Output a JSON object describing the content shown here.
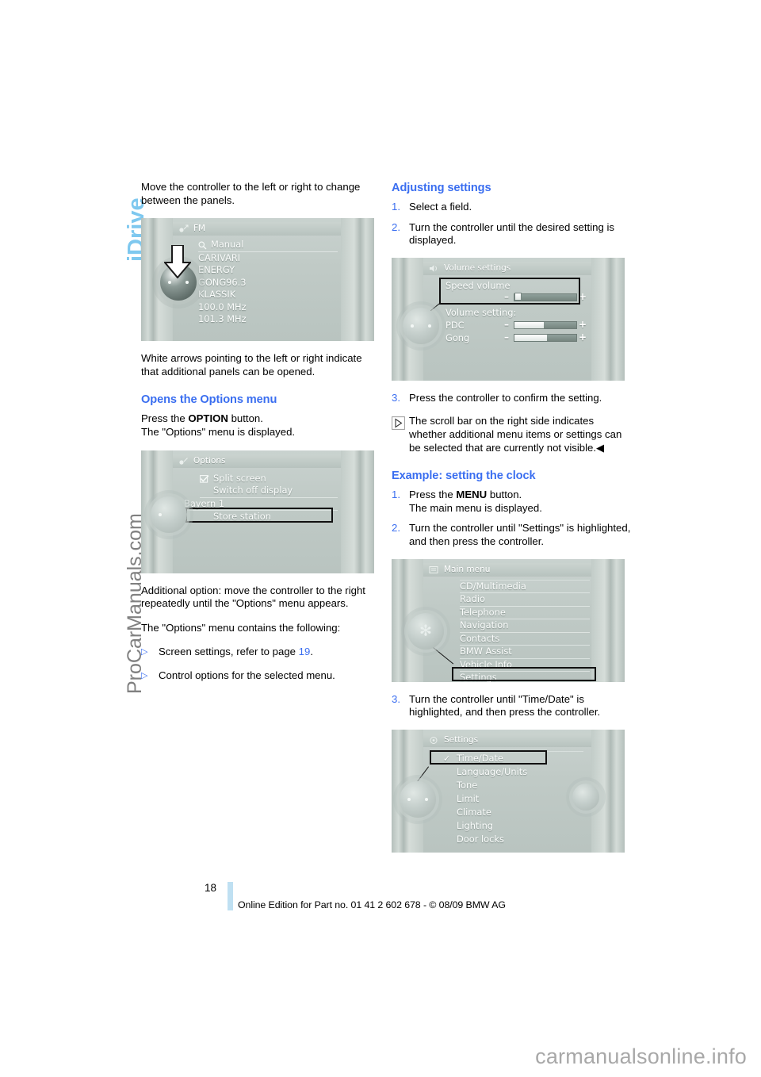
{
  "page": {
    "chapter_label": "iDrive",
    "watermark_side": "ProCarManuals.com",
    "watermark_bottom": "carmanualsonline.info",
    "number": "18",
    "footer_text": "Online Edition for Part no. 01 41 2 602 678 - © 08/09 BMW AG",
    "accent_blue": "#3a6ef0",
    "chapter_blue": "#7ec8ef",
    "rule_blue": "#bfe0f2"
  },
  "left_column": {
    "intro": "Move the controller to the left or right to change between the panels.",
    "caption_arrows": "White arrows pointing to the left or right indicate that additional panels can be opened.",
    "heading_options": "Opens the Options menu",
    "press_option_pre": "Press the ",
    "press_option_bold": "OPTION",
    "press_option_post": " button.",
    "options_displayed": "The \"Options\" menu is displayed.",
    "additional_option": "Additional option: move the controller to the right repeatedly until the \"Options\" menu appears.",
    "options_contains": "The \"Options\" menu contains the following:",
    "bullets": [
      {
        "marker": "▷",
        "text_pre": "Screen settings, refer to page ",
        "page_ref": "19",
        "text_post": "."
      },
      {
        "marker": "▷",
        "text_pre": "Control options for the selected menu.",
        "page_ref": "",
        "text_post": ""
      }
    ]
  },
  "right_column": {
    "heading_adjusting": "Adjusting settings",
    "steps_adjusting": [
      {
        "num": "1.",
        "text": "Select a field."
      },
      {
        "num": "2.",
        "text": "Turn the controller until the desired setting is displayed."
      }
    ],
    "step_three": {
      "num": "3.",
      "text": "Press the controller to confirm the setting."
    },
    "note_icon": "triangle-right-icon",
    "note_text": "The scroll bar on the right side indicates whether additional menu items or settings can be selected that are currently not visible.◀",
    "heading_example": "Example: setting the clock",
    "example_steps": [
      {
        "num": "1.",
        "text_pre": "Press the ",
        "bold": "MENU",
        "text_post": " button.",
        "line2": "The main menu is displayed."
      },
      {
        "num": "2.",
        "text_pre": "Turn the controller until \"Settings\" is highlighted, and then press the controller.",
        "bold": "",
        "text_post": "",
        "line2": ""
      }
    ],
    "step_three_clock": {
      "num": "3.",
      "text": "Turn the controller until \"Time/Date\" is highlighted, and then press the controller."
    }
  },
  "screenshots": {
    "fm_radio": {
      "name": "fm-radio-station-list",
      "header": "FM",
      "header_icon": "radio-icon",
      "items": [
        {
          "label": "Manual",
          "icon": "magnifier-icon",
          "separator": true
        },
        {
          "label": "CARIVARI",
          "icon": "",
          "separator": false
        },
        {
          "label": "ENERGY",
          "icon": "",
          "separator": false
        },
        {
          "label": "GONG96.3",
          "icon": "",
          "separator": false
        },
        {
          "label": "KLASSIK",
          "icon": "",
          "separator": false
        },
        {
          "label": "100.0 MHz",
          "icon": "",
          "separator": false
        },
        {
          "label": "101.3 MHz",
          "icon": "",
          "separator": false
        }
      ]
    },
    "options": {
      "name": "options-menu",
      "header": "Options",
      "header_icon": "options-icon",
      "items": [
        {
          "label": "Split screen",
          "icon": "checkbox-checked-icon"
        },
        {
          "label": "Switch off display",
          "icon": ""
        },
        {
          "label": "Bayern 1",
          "icon": ""
        },
        {
          "label": "Store station",
          "icon": "",
          "selected": true
        }
      ]
    },
    "volume": {
      "name": "volume-settings",
      "header": "Volume settings",
      "header_icon": "speaker-icon",
      "speed_volume_label": "Speed volume",
      "speed_volume_level": 18,
      "section_label": "Volume setting:",
      "sliders": [
        {
          "label": "PDC",
          "level": 48
        },
        {
          "label": "Gong",
          "level": 52
        }
      ]
    },
    "main_menu": {
      "name": "main-menu",
      "header": "Main menu",
      "header_icon": "menu-icon",
      "items": [
        {
          "label": "CD/Multimedia",
          "selected": false
        },
        {
          "label": "Radio",
          "selected": false
        },
        {
          "label": "Telephone",
          "selected": false
        },
        {
          "label": "Navigation",
          "selected": false
        },
        {
          "label": "Contacts",
          "selected": false
        },
        {
          "label": "BMW Assist",
          "selected": false
        },
        {
          "label": "Vehicle Info",
          "selected": false
        },
        {
          "label": "Settings",
          "selected": true
        }
      ]
    },
    "settings": {
      "name": "settings-menu",
      "header": "Settings",
      "header_icon": "gear-icon",
      "items": [
        {
          "label": "Time/Date",
          "check": "✓",
          "selected": true
        },
        {
          "label": "Language/Units",
          "check": "",
          "selected": false
        },
        {
          "label": "Tone",
          "check": "",
          "selected": false
        },
        {
          "label": "Limit",
          "check": "",
          "selected": false
        },
        {
          "label": "Climate",
          "check": "",
          "selected": false
        },
        {
          "label": "Lighting",
          "check": "",
          "selected": false
        },
        {
          "label": "Door locks",
          "check": "",
          "selected": false
        }
      ]
    }
  }
}
